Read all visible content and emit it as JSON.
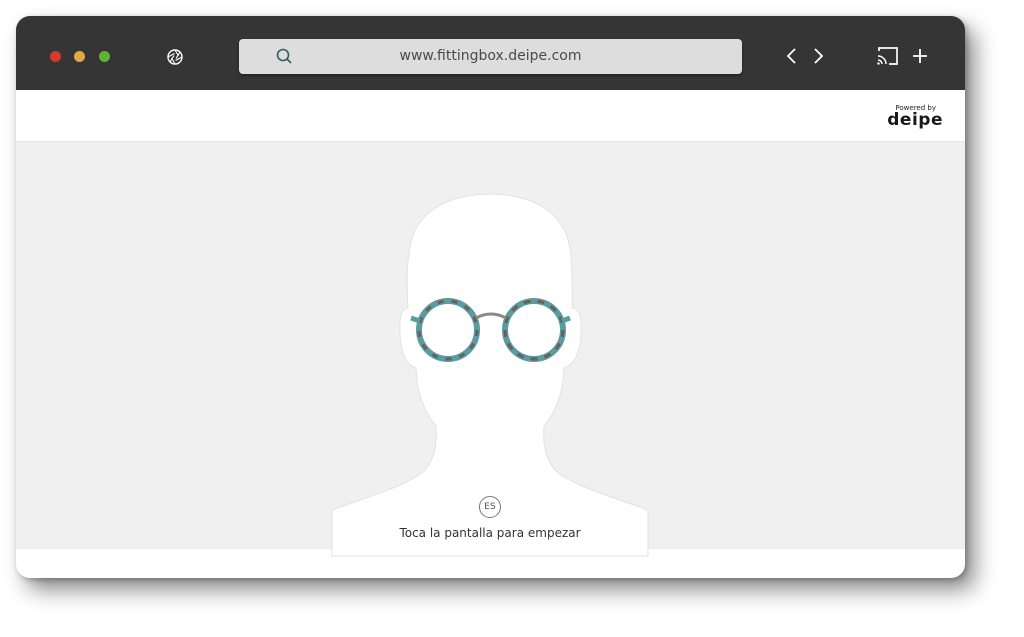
{
  "browser": {
    "url": "www.fittingbox.deipe.com",
    "icons": {
      "aperture": "aperture-icon",
      "search": "search-icon",
      "back": "chevron-left-icon",
      "forward": "chevron-right-icon",
      "cast": "cast-icon",
      "new_tab": "plus-icon"
    },
    "traffic_lights": [
      "#d53a2e",
      "#e0a84a",
      "#5fb530"
    ]
  },
  "header": {
    "powered_by": "Powered by",
    "brand": "deipe"
  },
  "stage": {
    "language_badge": "ES",
    "call_to_action": "Toca la pantalla para empezar"
  },
  "colors": {
    "toolbar": "#353535",
    "stage_background": "#f0f0f0",
    "silhouette": "#ffffff"
  }
}
